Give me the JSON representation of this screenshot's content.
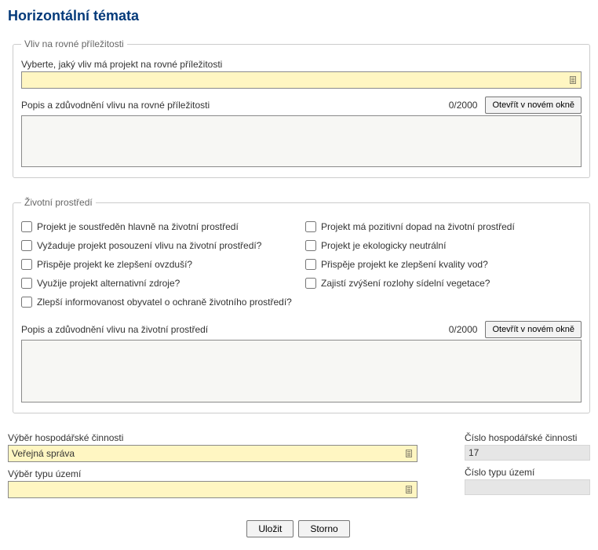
{
  "page": {
    "title": "Horizontální témata"
  },
  "equal": {
    "legend": "Vliv na rovné příležitosti",
    "select_label": "Vyberte, jaký vliv má projekt na rovné příležitosti",
    "select_value": "",
    "desc_label": "Popis a zdůvodnění vlivu na rovné příležitosti",
    "counter": "0/2000",
    "open_btn": "Otevřít v novém okně",
    "textarea_value": ""
  },
  "env": {
    "legend": "Životní prostředí",
    "checks_left": [
      "Projekt je soustředěn hlavně na životní prostředí",
      "Vyžaduje projekt posouzení vlivu na životní prostředí?",
      "Přispěje projekt ke zlepšení ovzduší?",
      "Využije projekt alternativní zdroje?",
      "Zlepší informovanost obyvatel o ochraně životního prostředí?"
    ],
    "checks_right": [
      "Projekt má pozitivní dopad na životní prostředí",
      "Projekt je ekologicky neutrální",
      "Přispěje projekt ke zlepšení kvality vod?",
      "Zajistí zvýšení rozlohy sídelní vegetace?"
    ],
    "desc_label": "Popis a zdůvodnění vlivu na životní prostředí",
    "counter": "0/2000",
    "open_btn": "Otevřít v novém okně",
    "textarea_value": ""
  },
  "bottom": {
    "activity_label": "Výběr hospodářské činnosti",
    "activity_value": "Veřejná správa",
    "activity_num_label": "Číslo hospodářské činnosti",
    "activity_num_value": "17",
    "territory_label": "Výběr typu území",
    "territory_value": "",
    "territory_num_label": "Číslo typu území",
    "territory_num_value": ""
  },
  "buttons": {
    "save": "Uložit",
    "cancel": "Storno"
  }
}
